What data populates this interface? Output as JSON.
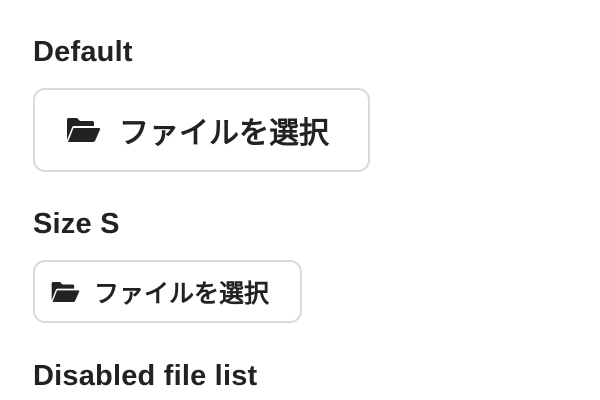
{
  "sections": {
    "default": {
      "heading": "Default",
      "button_label": "ファイルを選択",
      "button_icon": "folder-open-icon"
    },
    "size_s": {
      "heading": "Size S",
      "button_label": "ファイルを選択",
      "button_icon": "folder-open-icon"
    },
    "disabled_file_list": {
      "heading": "Disabled file list"
    }
  },
  "colors": {
    "text": "#222222",
    "button_border": "#d9d9d9",
    "background": "#ffffff"
  }
}
